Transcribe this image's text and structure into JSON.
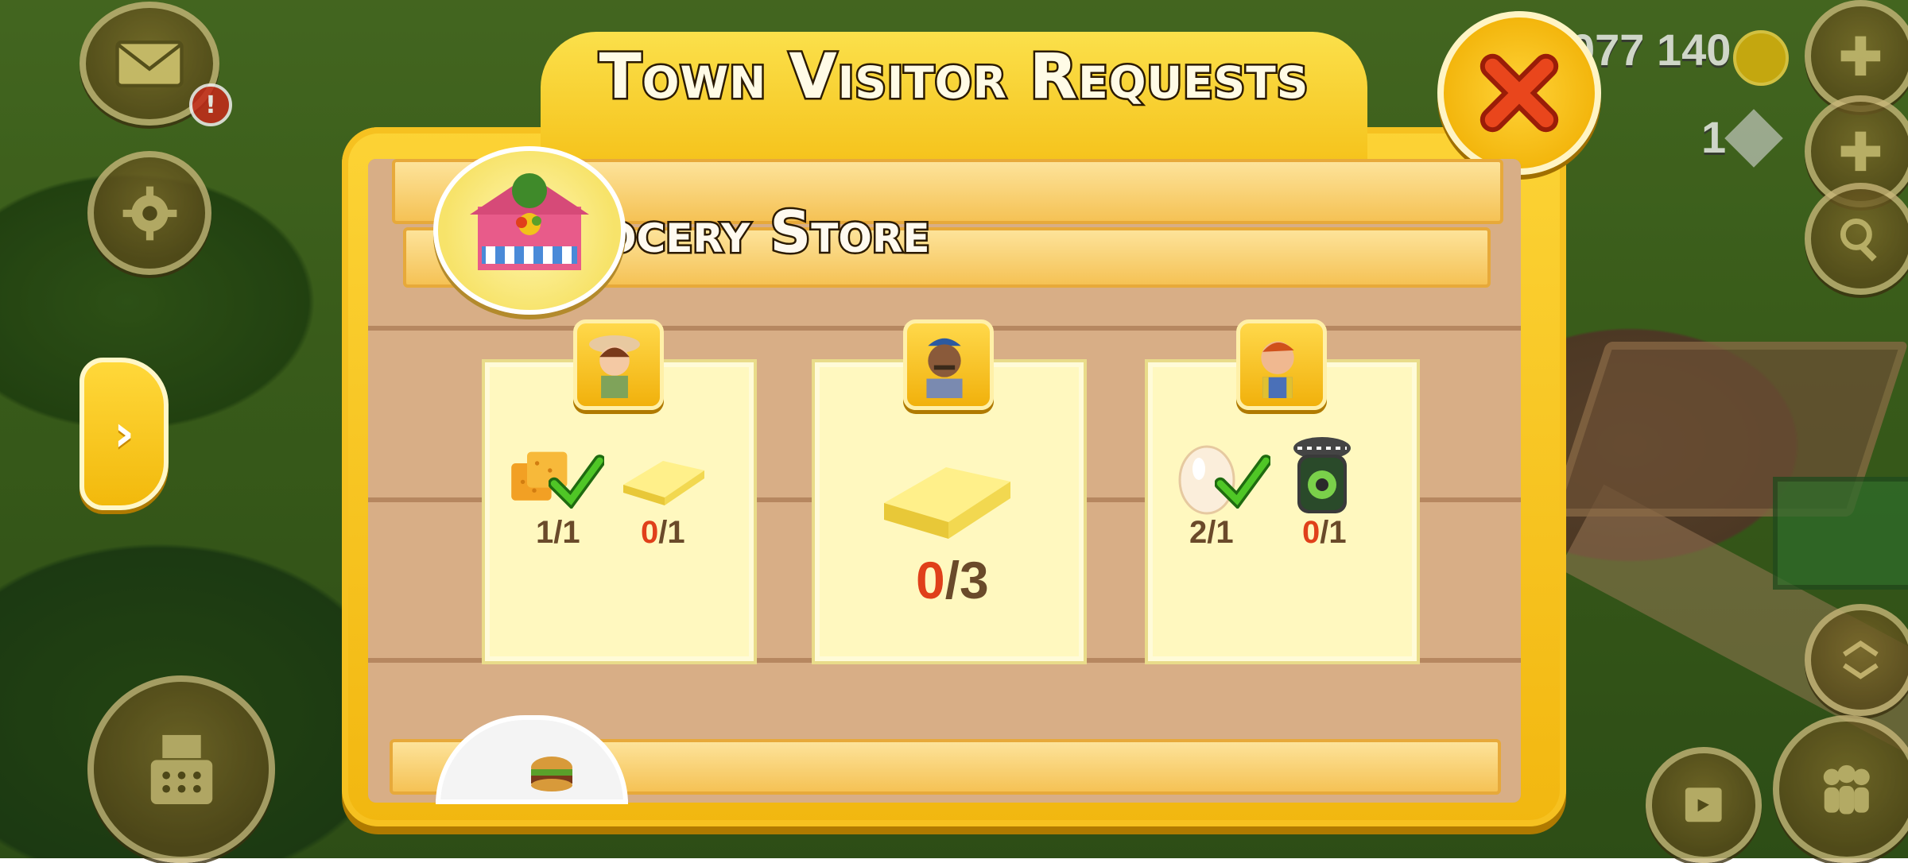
{
  "window_title": "Town Visitor Requests",
  "store": {
    "name": "Grocery Store"
  },
  "hud": {
    "coins": "077 140",
    "gems": "1",
    "mail_alert": "!"
  },
  "nav": {
    "arrow": "›"
  },
  "visitors": [
    {
      "portrait": "woman-hat-portrait",
      "items": [
        {
          "icon": "cornbread-icon",
          "have": "1",
          "need": "/1",
          "done": true
        },
        {
          "icon": "butter-icon",
          "have": "0",
          "need": "/1",
          "done": false
        }
      ]
    },
    {
      "portrait": "man-cap-portrait",
      "items": [
        {
          "icon": "butter-icon",
          "have": "0",
          "need": "/3",
          "done": false
        }
      ]
    },
    {
      "portrait": "farmer-overalls-portrait",
      "items": [
        {
          "icon": "egg-icon",
          "have": "2",
          "need": "/1",
          "done": true
        },
        {
          "icon": "jam-jar-icon",
          "have": "0",
          "need": "/1",
          "done": false
        }
      ]
    }
  ],
  "colors": {
    "panel": "#f5c21a",
    "accent_red": "#e0401a",
    "text_brown": "#6a4a2a"
  }
}
